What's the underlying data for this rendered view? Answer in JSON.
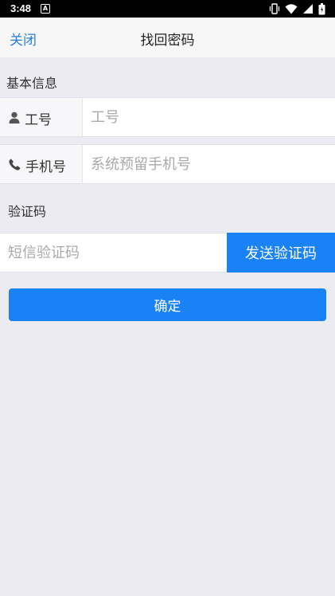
{
  "status_bar": {
    "time": "3:48",
    "notification_glyph": "A",
    "icons": [
      "vibrate-icon",
      "wifi-icon",
      "signal-icon",
      "battery-icon"
    ]
  },
  "nav": {
    "close_label": "关闭",
    "title": "找回密码"
  },
  "basic_info": {
    "section_label": "基本信息",
    "employee_id": {
      "label": "工号",
      "icon": "person-icon",
      "value": "",
      "placeholder": "工号"
    },
    "phone": {
      "label": "手机号",
      "icon": "phone-icon",
      "value": "",
      "placeholder": "系统预留手机号"
    }
  },
  "verification": {
    "section_label": "验证码",
    "code": {
      "value": "",
      "placeholder": "短信验证码"
    },
    "send_button_label": "发送验证码"
  },
  "confirm_button_label": "确定",
  "colors": {
    "accent": "#1a82f7",
    "link": "#2a7fd8",
    "background": "#ecebf1"
  }
}
